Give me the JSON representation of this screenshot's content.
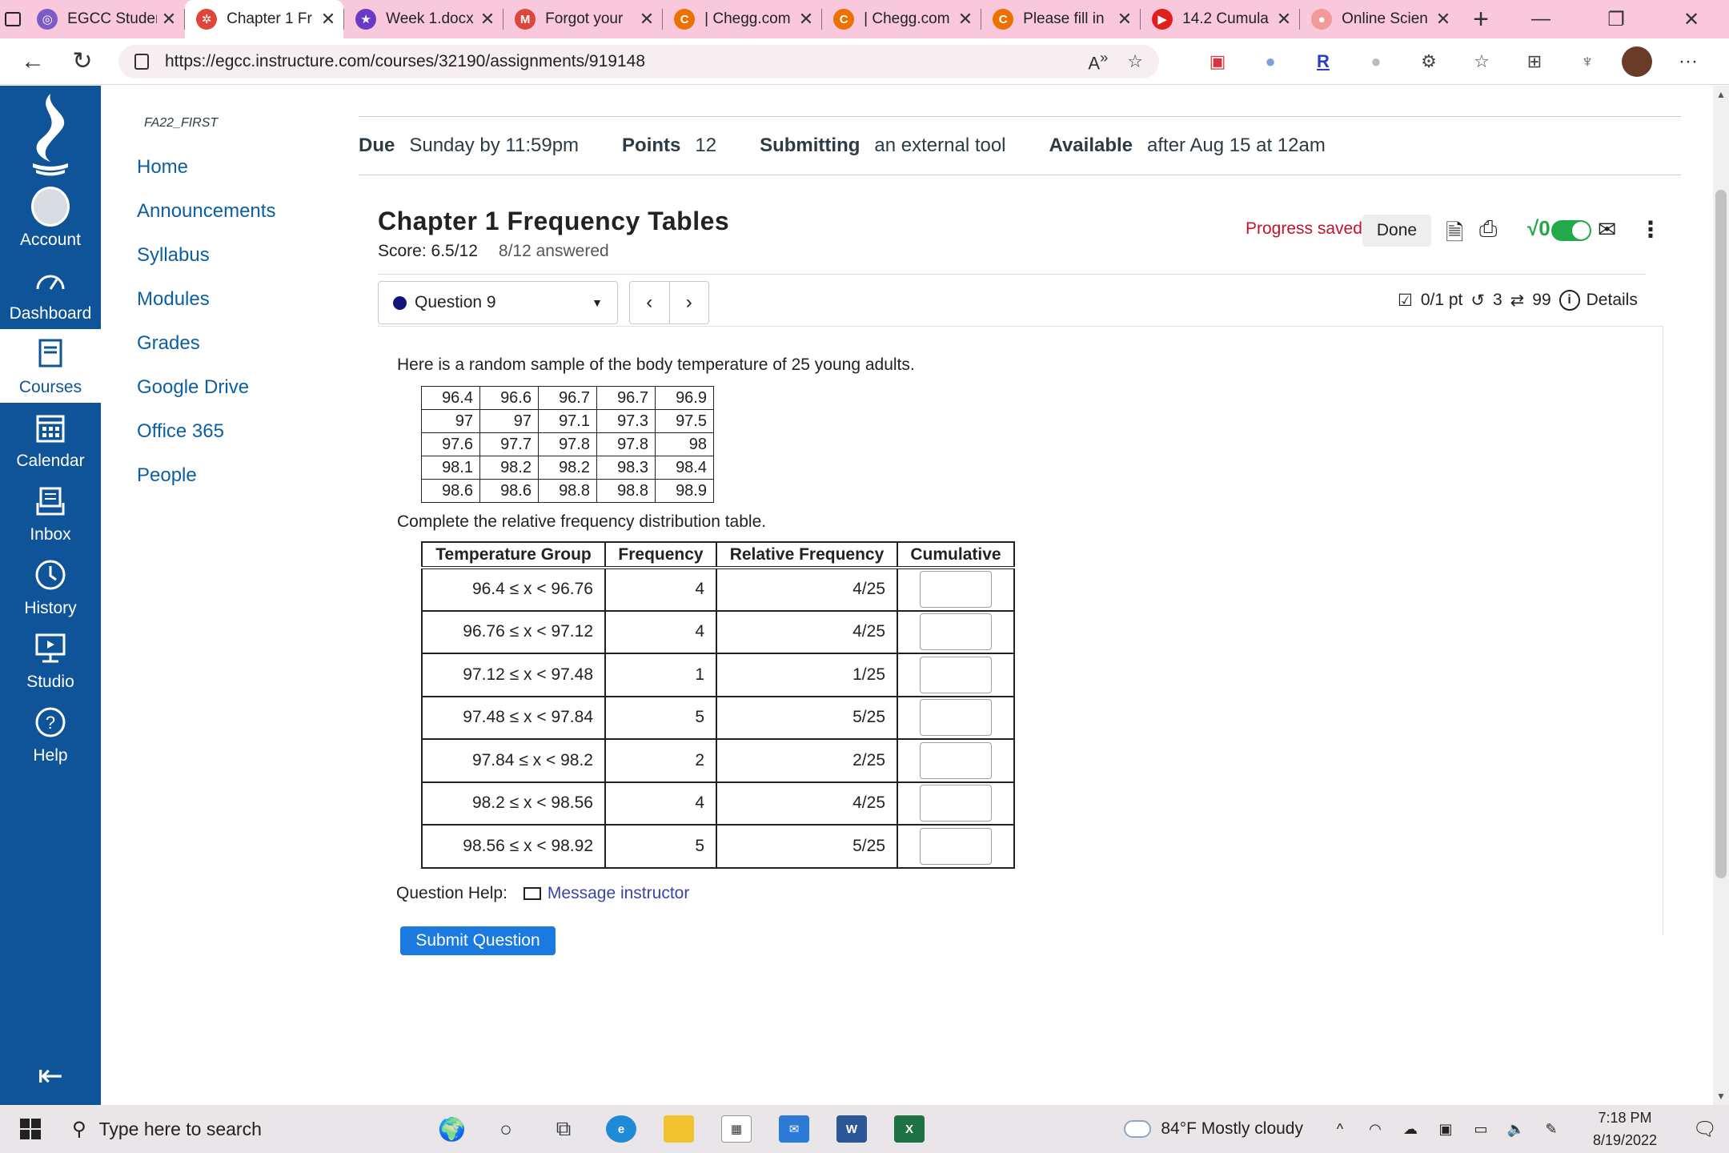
{
  "browser": {
    "tabs": [
      {
        "label": "EGCC Studen",
        "favicon_color": "#7b5cc7",
        "favicon_char": "◎",
        "active": false
      },
      {
        "label": "Chapter 1 Fr",
        "favicon_color": "#e0453c",
        "favicon_char": "✲",
        "active": true
      },
      {
        "label": "Week 1.docx",
        "favicon_color": "#6a3ac4",
        "favicon_char": "★",
        "active": false
      },
      {
        "label": "Forgot your",
        "favicon_color": "#e0453c",
        "favicon_char": "M",
        "active": false
      },
      {
        "label": "| Chegg.com",
        "favicon_color": "#eb7100",
        "favicon_char": "C",
        "active": false
      },
      {
        "label": "| Chegg.com",
        "favicon_color": "#eb7100",
        "favicon_char": "C",
        "active": false
      },
      {
        "label": "Please fill in",
        "favicon_color": "#eb7100",
        "favicon_char": "C",
        "active": false
      },
      {
        "label": "14.2 Cumula",
        "favicon_color": "#e02020",
        "favicon_char": "▶",
        "active": false
      },
      {
        "label": "Online Scien",
        "favicon_color": "#f29a9a",
        "favicon_char": "●",
        "active": false
      }
    ],
    "url": "https://egcc.instructure.com/courses/32190/assignments/919148"
  },
  "global_nav": {
    "items": [
      {
        "label": "Account",
        "icon": "account-avatar-icon"
      },
      {
        "label": "Dashboard",
        "icon": "dashboard-gauge-icon"
      },
      {
        "label": "Courses",
        "icon": "courses-book-icon"
      },
      {
        "label": "Calendar",
        "icon": "calendar-icon"
      },
      {
        "label": "Inbox",
        "icon": "inbox-icon"
      },
      {
        "label": "History",
        "icon": "clock-icon"
      },
      {
        "label": "Studio",
        "icon": "studio-icon"
      },
      {
        "label": "Help",
        "icon": "help-icon"
      }
    ]
  },
  "course_nav": {
    "course_code": "FA22_FIRST",
    "items": [
      "Home",
      "Announcements",
      "Syllabus",
      "Modules",
      "Grades",
      "Google Drive",
      "Office 365",
      "People"
    ]
  },
  "assignment": {
    "due_label": "Due",
    "due_value": "Sunday by 11:59pm",
    "points_label": "Points",
    "points_value": "12",
    "submitting_label": "Submitting",
    "submitting_value": "an external tool",
    "available_label": "Available",
    "available_value": "after Aug 15 at 12am"
  },
  "question": {
    "title": "Chapter 1 Frequency Tables",
    "score": "Score: 6.5/12",
    "answered": "8/12 answered",
    "progress": "Progress saved",
    "done_label": "Done",
    "selector": "Question 9",
    "points": "0/1 pt",
    "retries": "3",
    "attempts": "99",
    "details": "Details",
    "prompt": "Here is a random sample of the body temperature of 25 young adults.",
    "sample": [
      [
        "96.4",
        "96.6",
        "96.7",
        "96.7",
        "96.9"
      ],
      [
        "97",
        "97",
        "97.1",
        "97.3",
        "97.5"
      ],
      [
        "97.6",
        "97.7",
        "97.8",
        "97.8",
        "98"
      ],
      [
        "98.1",
        "98.2",
        "98.2",
        "98.3",
        "98.4"
      ],
      [
        "98.6",
        "98.6",
        "98.8",
        "98.8",
        "98.9"
      ]
    ],
    "instruction": "Complete the relative frequency distribution table.",
    "table_headers": [
      "Temperature Group",
      "Frequency",
      "Relative Frequency",
      "Cumulative"
    ],
    "rows": [
      {
        "group": "96.4 ≤ x < 96.76",
        "frequency": "4",
        "relative": "4/25",
        "cumulative": ""
      },
      {
        "group": "96.76 ≤ x < 97.12",
        "frequency": "4",
        "relative": "4/25",
        "cumulative": ""
      },
      {
        "group": "97.12 ≤ x < 97.48",
        "frequency": "1",
        "relative": "1/25",
        "cumulative": ""
      },
      {
        "group": "97.48 ≤ x < 97.84",
        "frequency": "5",
        "relative": "5/25",
        "cumulative": ""
      },
      {
        "group": "97.84 ≤ x < 98.2",
        "frequency": "2",
        "relative": "2/25",
        "cumulative": ""
      },
      {
        "group": "98.2 ≤ x < 98.56",
        "frequency": "4",
        "relative": "4/25",
        "cumulative": ""
      },
      {
        "group": "98.56 ≤ x < 98.92",
        "frequency": "5",
        "relative": "5/25",
        "cumulative": ""
      }
    ],
    "help_label": "Question Help:",
    "message_link": "Message instructor",
    "submit_label": "Submit Question"
  },
  "taskbar": {
    "search_placeholder": "Type here to search",
    "weather": "84°F  Mostly cloudy",
    "time": "7:18 PM",
    "date": "8/19/2022"
  }
}
